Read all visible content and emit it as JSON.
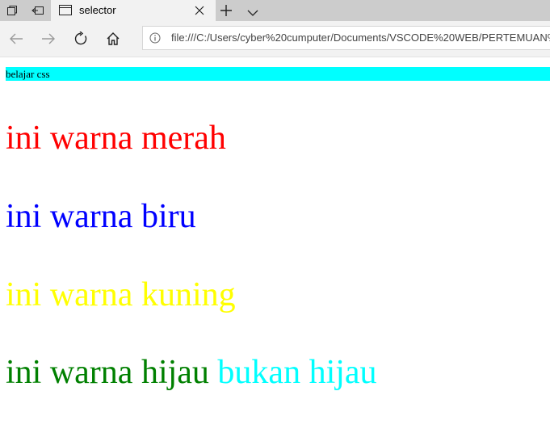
{
  "browser": {
    "tab_title": "selector",
    "url": "file:///C:/Users/cyber%20cumputer/Documents/VSCODE%20WEB/PERTEMUAN%2"
  },
  "page": {
    "banner_text": "belajar css",
    "banner_bg": "#00ffff",
    "lines": [
      {
        "text": "ini warna merah",
        "color": "#ff0000"
      },
      {
        "text": "ini warna biru",
        "color": "#0000ff"
      },
      {
        "text": "ini warna kuning",
        "color": "#ffff00"
      },
      {
        "text": "ini warna hijau",
        "color": "#008000"
      },
      {
        "text": "bukan hijau",
        "color": "#00ffff"
      }
    ]
  },
  "icons": {
    "tab_aside": "tab-aside-icon",
    "tab_restore": "tab-restore-icon",
    "favicon": "page-icon",
    "close": "close-icon",
    "new_tab": "plus-icon",
    "tab_menu": "chevron-down-icon",
    "back": "back-arrow-icon",
    "forward": "forward-arrow-icon",
    "refresh": "refresh-icon",
    "home": "home-icon",
    "info": "info-icon"
  }
}
